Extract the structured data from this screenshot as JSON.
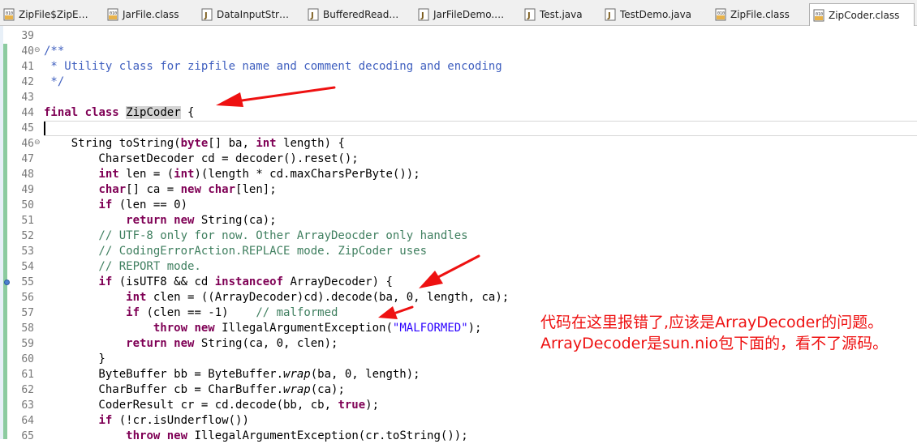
{
  "tabs": [
    {
      "label": "ZipFile$ZipE…",
      "icon": "class-file-icon",
      "active": false
    },
    {
      "label": "JarFile.class",
      "icon": "class-file-icon",
      "active": false
    },
    {
      "label": "DataInputStr…",
      "icon": "java-file-icon",
      "active": false
    },
    {
      "label": "BufferedRead…",
      "icon": "java-file-icon",
      "active": false
    },
    {
      "label": "JarFileDemo.…",
      "icon": "java-file-icon",
      "active": false
    },
    {
      "label": "Test.java",
      "icon": "java-file-icon",
      "active": false
    },
    {
      "label": "TestDemo.java",
      "icon": "java-file-icon",
      "active": false
    },
    {
      "label": "ZipFile.class",
      "icon": "class-file-icon",
      "active": false
    },
    {
      "label": "ZipCoder.class",
      "icon": "class-file-icon",
      "active": true
    }
  ],
  "lines": [
    {
      "n": "39",
      "tokens": []
    },
    {
      "n": "40",
      "fold": "⊖",
      "tokens": [
        {
          "t": "/**",
          "c": "jd"
        }
      ]
    },
    {
      "n": "41",
      "tokens": [
        {
          "t": " * Utility class for zipfile name and comment decoding and encoding",
          "c": "jd"
        }
      ]
    },
    {
      "n": "42",
      "tokens": [
        {
          "t": " */",
          "c": "jd"
        }
      ]
    },
    {
      "n": "43",
      "tokens": []
    },
    {
      "n": "44",
      "tokens": [
        {
          "t": "final",
          "c": "kw"
        },
        {
          "t": " "
        },
        {
          "t": "class",
          "c": "kw"
        },
        {
          "t": " "
        },
        {
          "t": "ZipCoder",
          "c": "hl"
        },
        {
          "t": " {"
        }
      ]
    },
    {
      "n": "45",
      "current": true,
      "tokens": []
    },
    {
      "n": "46",
      "fold": "⊖",
      "tokens": [
        {
          "t": "    String toString("
        },
        {
          "t": "byte",
          "c": "kw"
        },
        {
          "t": "[] ba, "
        },
        {
          "t": "int",
          "c": "kw"
        },
        {
          "t": " length) {"
        }
      ]
    },
    {
      "n": "47",
      "tokens": [
        {
          "t": "        CharsetDecoder cd = decoder().reset();"
        }
      ]
    },
    {
      "n": "48",
      "tokens": [
        {
          "t": "        "
        },
        {
          "t": "int",
          "c": "kw"
        },
        {
          "t": " len = ("
        },
        {
          "t": "int",
          "c": "kw"
        },
        {
          "t": ")(length * cd.maxCharsPerByte());"
        }
      ]
    },
    {
      "n": "49",
      "tokens": [
        {
          "t": "        "
        },
        {
          "t": "char",
          "c": "kw"
        },
        {
          "t": "[] ca = "
        },
        {
          "t": "new",
          "c": "kw"
        },
        {
          "t": " "
        },
        {
          "t": "char",
          "c": "kw"
        },
        {
          "t": "[len];"
        }
      ]
    },
    {
      "n": "50",
      "tokens": [
        {
          "t": "        "
        },
        {
          "t": "if",
          "c": "kw"
        },
        {
          "t": " (len == 0)"
        }
      ]
    },
    {
      "n": "51",
      "tokens": [
        {
          "t": "            "
        },
        {
          "t": "return",
          "c": "kw"
        },
        {
          "t": " "
        },
        {
          "t": "new",
          "c": "kw"
        },
        {
          "t": " String(ca);"
        }
      ]
    },
    {
      "n": "52",
      "tokens": [
        {
          "t": "        // UTF-8 only for now. Other ArrayDeocder only handles",
          "c": "cm"
        }
      ]
    },
    {
      "n": "53",
      "tokens": [
        {
          "t": "        // CodingErrorAction.REPLACE mode. ZipCoder uses",
          "c": "cm"
        }
      ]
    },
    {
      "n": "54",
      "tokens": [
        {
          "t": "        // REPORT mode.",
          "c": "cm"
        }
      ]
    },
    {
      "n": "55",
      "marker": true,
      "tokens": [
        {
          "t": "        "
        },
        {
          "t": "if",
          "c": "kw"
        },
        {
          "t": " (isUTF8 && cd "
        },
        {
          "t": "instanceof",
          "c": "kw"
        },
        {
          "t": " ArrayDecoder) {"
        }
      ]
    },
    {
      "n": "56",
      "tokens": [
        {
          "t": "            "
        },
        {
          "t": "int",
          "c": "kw"
        },
        {
          "t": " clen = ((ArrayDecoder)cd).decode(ba, 0, length, ca);"
        }
      ]
    },
    {
      "n": "57",
      "tokens": [
        {
          "t": "            "
        },
        {
          "t": "if",
          "c": "kw"
        },
        {
          "t": " (clen == -1)    "
        },
        {
          "t": "// malformed",
          "c": "cm"
        }
      ]
    },
    {
      "n": "58",
      "tokens": [
        {
          "t": "                "
        },
        {
          "t": "throw",
          "c": "kw"
        },
        {
          "t": " "
        },
        {
          "t": "new",
          "c": "kw"
        },
        {
          "t": " IllegalArgumentException("
        },
        {
          "t": "\"MALFORMED\"",
          "c": "st"
        },
        {
          "t": ");"
        }
      ]
    },
    {
      "n": "59",
      "tokens": [
        {
          "t": "            "
        },
        {
          "t": "return",
          "c": "kw"
        },
        {
          "t": " "
        },
        {
          "t": "new",
          "c": "kw"
        },
        {
          "t": " String(ca, 0, clen);"
        }
      ]
    },
    {
      "n": "60",
      "tokens": [
        {
          "t": "        }"
        }
      ]
    },
    {
      "n": "61",
      "tokens": [
        {
          "t": "        ByteBuffer bb = ByteBuffer."
        },
        {
          "t": "wrap",
          "c": "it"
        },
        {
          "t": "(ba, 0, length);"
        }
      ]
    },
    {
      "n": "62",
      "tokens": [
        {
          "t": "        CharBuffer cb = CharBuffer."
        },
        {
          "t": "wrap",
          "c": "it"
        },
        {
          "t": "(ca);"
        }
      ]
    },
    {
      "n": "63",
      "tokens": [
        {
          "t": "        CoderResult cr = cd.decode(bb, cb, "
        },
        {
          "t": "true",
          "c": "kw"
        },
        {
          "t": ");"
        }
      ]
    },
    {
      "n": "64",
      "tokens": [
        {
          "t": "        "
        },
        {
          "t": "if",
          "c": "kw"
        },
        {
          "t": " (!cr.isUnderflow())"
        }
      ]
    },
    {
      "n": "65",
      "tokens": [
        {
          "t": "            "
        },
        {
          "t": "throw",
          "c": "kw"
        },
        {
          "t": " "
        },
        {
          "t": "new",
          "c": "kw"
        },
        {
          "t": " IllegalArgumentException(cr.toString());"
        }
      ]
    }
  ],
  "annotation": {
    "text": "代码在这里报错了,应该是ArrayDecoder的问题。ArrayDecoder是sun.nio包下面的，看不了源码。",
    "color": "#ee1111"
  }
}
